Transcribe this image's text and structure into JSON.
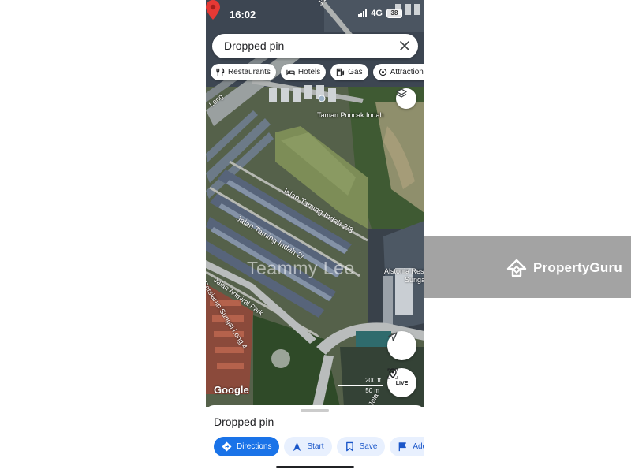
{
  "status": {
    "time": "16:02",
    "network": "4G",
    "battery": "38"
  },
  "search": {
    "value": "Dropped pin"
  },
  "chips": [
    {
      "label": "Restaurants",
      "icon": "fork-knife-icon"
    },
    {
      "label": "Hotels",
      "icon": "bed-icon"
    },
    {
      "label": "Gas",
      "icon": "gas-pump-icon"
    },
    {
      "label": "Attractions",
      "icon": "attraction-icon"
    }
  ],
  "map": {
    "labels": {
      "jalan_sungai_long": "Jalan Sungai Lo",
      "long": "Long",
      "taman": "Taman Puncak Indah",
      "taming_a": "Jalan Taming Indah 2/3",
      "taming_b": "Jalan Taming Indah 2/",
      "alstonia": "Alstonia Resi",
      "sungai": "Sunga",
      "admiral": "Jalan Admiral Park",
      "persiaran": "Persiaran Sungai Long 4",
      "bottom_right": "Jala"
    },
    "watermark": "Teammy Lee",
    "logo": "Google",
    "scale_top": "200 ft",
    "scale_bottom": "50 m",
    "live_label": "LIVE"
  },
  "sheet": {
    "title": "Dropped pin",
    "actions": [
      {
        "label": "Directions",
        "icon": "directions-icon",
        "primary": true
      },
      {
        "label": "Start",
        "icon": "navigation-arrow-icon",
        "primary": false
      },
      {
        "label": "Save",
        "icon": "bookmark-icon",
        "primary": false
      },
      {
        "label": "Add l",
        "icon": "flag-icon",
        "primary": false
      }
    ]
  },
  "brand": {
    "name": "PropertyGuru"
  },
  "colors": {
    "accent": "#1a73e8",
    "pin": "#e53935"
  }
}
